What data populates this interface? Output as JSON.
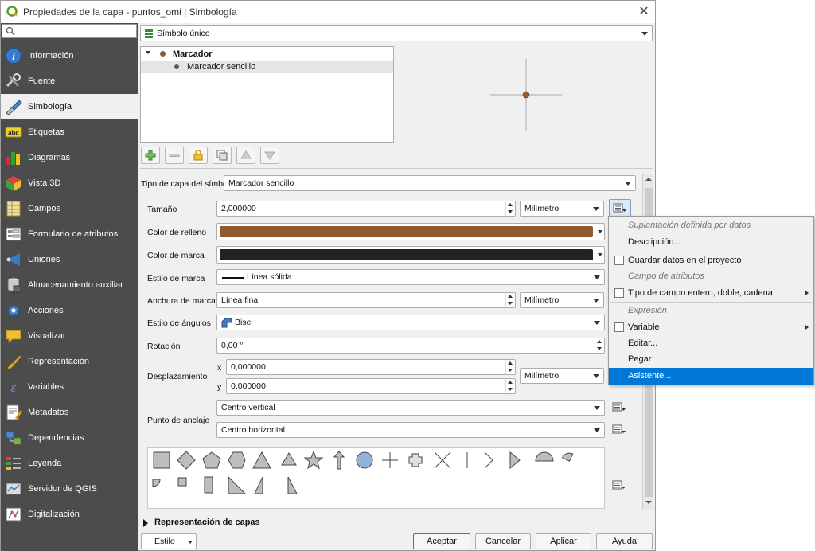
{
  "window": {
    "title": "Propiedades de la capa - puntos_omi | Simbología"
  },
  "sidebar": {
    "search_placeholder": "",
    "items": [
      {
        "label": "Información",
        "icon": "info-icon"
      },
      {
        "label": "Fuente",
        "icon": "source-tools-icon"
      },
      {
        "label": "Simbología",
        "icon": "paintbrush-icon"
      },
      {
        "label": "Etiquetas",
        "icon": "abc-labels-icon"
      },
      {
        "label": "Diagramas",
        "icon": "diagram-icon"
      },
      {
        "label": "Vista 3D",
        "icon": "cube-3d-icon"
      },
      {
        "label": "Campos",
        "icon": "fields-icon"
      },
      {
        "label": "Formulario de atributos",
        "icon": "form-icon"
      },
      {
        "label": "Uniones",
        "icon": "joins-icon"
      },
      {
        "label": "Almacenamiento auxiliar",
        "icon": "storage-icon"
      },
      {
        "label": "Acciones",
        "icon": "actions-gear-icon"
      },
      {
        "label": "Visualizar",
        "icon": "speech-bubble-icon"
      },
      {
        "label": "Representación",
        "icon": "render-brush-icon"
      },
      {
        "label": "Variables",
        "icon": "variables-icon"
      },
      {
        "label": "Metadatos",
        "icon": "metadata-icon"
      },
      {
        "label": "Dependencias",
        "icon": "dependencies-icon"
      },
      {
        "label": "Leyenda",
        "icon": "legend-icon"
      },
      {
        "label": "Servidor de QGIS",
        "icon": "server-icon"
      },
      {
        "label": "Digitalización",
        "icon": "digitizing-icon"
      }
    ],
    "active_index": 2
  },
  "renderer": {
    "value": "Símbolo único"
  },
  "symbol_tree": {
    "root": "Marcador",
    "child": "Marcador sencillo"
  },
  "preview": {
    "marker_color": "#9a5a2f"
  },
  "layer_type": {
    "label": "Tipo de capa del símbolo",
    "value": "Marcador sencillo"
  },
  "props": {
    "size": {
      "label": "Tamaño",
      "value": "2,000000",
      "unit": "Milímetro"
    },
    "fill_color": {
      "label": "Color de relleno",
      "color": "#8f5a30"
    },
    "stroke_color": {
      "label": "Color de marca",
      "color": "#222222"
    },
    "stroke_style": {
      "label": "Estilo de marca",
      "value": "Línea sólida"
    },
    "stroke_width": {
      "label": "Anchura de marca",
      "value": "Línea fina",
      "unit": "Milímetro"
    },
    "join_style": {
      "label": "Estilo de ángulos",
      "value": "Bisel"
    },
    "rotation": {
      "label": "Rotación",
      "value": "0,00 °"
    },
    "offset": {
      "label": "Desplazamiento",
      "x_label": "x",
      "x_value": "0,000000",
      "y_label": "y",
      "y_value": "0,000000",
      "unit": "Milímetro"
    },
    "anchor": {
      "label": "Punto de anclaje",
      "vertical": "Centro vertical",
      "horizontal": "Centro horizontal"
    }
  },
  "layer_rendering": {
    "label": "Representación de capas"
  },
  "footer": {
    "style": "Estilo",
    "ok": "Aceptar",
    "cancel": "Cancelar",
    "apply": "Aplicar",
    "help": "Ayuda"
  },
  "context_menu": {
    "header1": "Suplantación definida por datos",
    "description": "Descripción...",
    "store_data": "Guardar datos en el proyecto",
    "header2": "Campo de atributos",
    "field_type": "Tipo de campo.entero, doble, cadena",
    "header3": "Expresión",
    "variable": "Variable",
    "edit": "Editar...",
    "paste": "Pegar",
    "assistant": "Asistente..."
  }
}
